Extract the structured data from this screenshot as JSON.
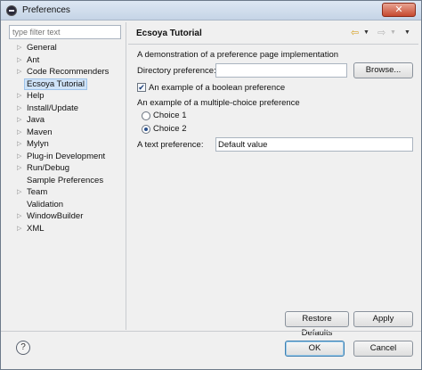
{
  "window": {
    "title": "Preferences",
    "close_label": "✕"
  },
  "filter": {
    "placeholder": "type filter text"
  },
  "tree": {
    "items": [
      {
        "label": "General",
        "expandable": true
      },
      {
        "label": "Ant",
        "expandable": true
      },
      {
        "label": "Code Recommenders",
        "expandable": true
      },
      {
        "label": "Ecsoya Tutorial",
        "expandable": false,
        "selected": true
      },
      {
        "label": "Help",
        "expandable": true
      },
      {
        "label": "Install/Update",
        "expandable": true
      },
      {
        "label": "Java",
        "expandable": true
      },
      {
        "label": "Maven",
        "expandable": true
      },
      {
        "label": "Mylyn",
        "expandable": true
      },
      {
        "label": "Plug-in Development",
        "expandable": true
      },
      {
        "label": "Run/Debug",
        "expandable": true
      },
      {
        "label": "Sample Preferences",
        "expandable": false
      },
      {
        "label": "Team",
        "expandable": true
      },
      {
        "label": "Validation",
        "expandable": false
      },
      {
        "label": "WindowBuilder",
        "expandable": true
      },
      {
        "label": "XML",
        "expandable": true
      }
    ]
  },
  "page": {
    "title": "Ecsoya Tutorial",
    "description": "A demonstration of a preference page implementation",
    "directory_label": "Directory preference:",
    "directory_value": "",
    "browse_label": "Browse...",
    "boolean_label": "An example of a boolean preference",
    "boolean_checked": true,
    "multichoice_label": "An example of a multiple-choice preference",
    "choice1_label": "Choice 1",
    "choice2_label": "Choice 2",
    "selected_choice": "Choice 2",
    "text_label": "A text preference:",
    "text_value": "Default value"
  },
  "buttons": {
    "restore_defaults": "Restore Defaults",
    "apply": "Apply",
    "ok": "OK",
    "cancel": "Cancel",
    "help": "?"
  },
  "icons": {
    "back": "back-arrow-icon",
    "forward": "forward-arrow-icon",
    "menu": "dropdown-icon",
    "help": "help-icon"
  }
}
